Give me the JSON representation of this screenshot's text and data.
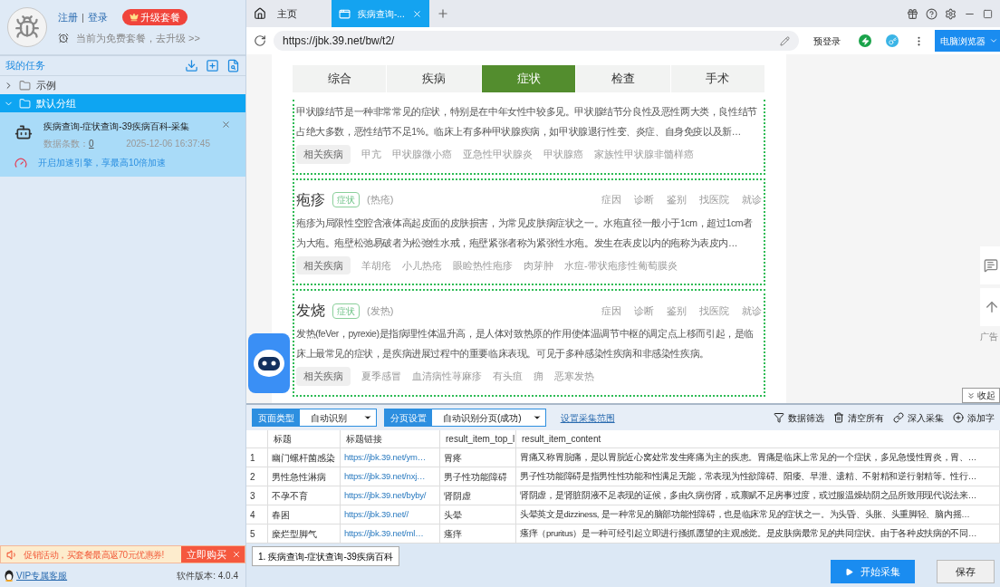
{
  "account": {
    "links": [
      "注册",
      "登录"
    ],
    "separator": "|",
    "upgrade_button": "升级套餐",
    "plan_note": "当前为免费套餐，去升级 >>"
  },
  "tasks": {
    "title": "我的任务",
    "groups": [
      {
        "label": "示例",
        "expanded": false,
        "selected": false
      },
      {
        "label": "默认分组",
        "expanded": true,
        "selected": true,
        "children": [
          {
            "title": "疾病查询-症状查询-39疾病百科-采集",
            "count_label": "数据条数：",
            "count": "0",
            "time": "2025-12-06 16:37:45",
            "boost": "开启加速引擎，享最高10倍加速"
          }
        ]
      }
    ]
  },
  "promo": {
    "text": "促销活动，买套餐最高返70元优惠券!",
    "button": "立即购买"
  },
  "footer": {
    "support_link": "VIP专属客服",
    "version": "软件版本: 4.0.4"
  },
  "browser": {
    "tabs": [
      {
        "label": "主页",
        "kind": "home",
        "selected": false
      },
      {
        "label": "疾病查询-...",
        "kind": "page",
        "selected": true
      }
    ],
    "url": "https://jbk.39.net/bw/t2/",
    "login": "预登录",
    "mode_button": "电脑浏览器"
  },
  "page": {
    "nav": [
      {
        "label": "综合",
        "selected": false
      },
      {
        "label": "疾病",
        "selected": false
      },
      {
        "label": "症状",
        "selected": true
      },
      {
        "label": "检查",
        "selected": false
      },
      {
        "label": "手术",
        "selected": false
      }
    ],
    "cards": [
      {
        "description": "甲状腺结节是一种非常常见的症状，特别是在中年女性中较多见。甲状腺结节分良性及恶性两大类，良性结节占绝大多数，恶性结节不足1%。临床上有多种甲状腺疾病，如甲状腺退行性变、炎症、自身免疫以及新…",
        "related_label": "相关疾病",
        "related": [
          "甲亢",
          "甲状腺微小癌",
          "亚急性甲状腺炎",
          "甲状腺癌",
          "家族性甲状腺非髓样癌"
        ]
      },
      {
        "name": "疱疹",
        "tag": "症状",
        "alias": "(热疮)",
        "links": [
          "症因",
          "诊断",
          "鉴别",
          "找医院",
          "就诊"
        ],
        "description": "疱疹为局限性空腔含液体高起皮面的皮肤损害，为常见皮肤病症状之一。水疱直径一般小于1cm，超过1cm者为大疱。疱壁松弛易破者为松弛性水戒，疱壁紧张者称为紧张性水疱。发生在表皮以内的疱称为表皮内…",
        "related_label": "相关疾病",
        "related": [
          "羊胡疮",
          "小儿热疮",
          "眼睑热性疱疹",
          "肉芽肿",
          "水痘-带状疱疹性葡萄膜炎"
        ]
      },
      {
        "name": "发烧",
        "tag": "症状",
        "alias": "(发热)",
        "links": [
          "症因",
          "诊断",
          "鉴别",
          "找医院",
          "就诊"
        ],
        "description": "发热(feVer，pyrexie)是指病理性体温升高，是人体对致热原的作用使体温调节中枢的调定点上移而引起，是临床上最常见的症状，是疾病进展过程中的重要临床表现。可见于多种感染性疾病和非感染性疾病。",
        "related_label": "相关疾病",
        "related": [
          "夏季感冒",
          "血清病性荨麻疹",
          "有头疽",
          "痈",
          "恶寒发热"
        ]
      }
    ],
    "ad_label": "广告",
    "collapse_button": "收起"
  },
  "collector": {
    "selects": [
      {
        "label": "页面类型",
        "value": "自动识别"
      },
      {
        "label": "分页设置",
        "value": "自动识别分页(成功)"
      }
    ],
    "range_link": "设置采集范围",
    "actions": [
      {
        "label": "数据筛选",
        "kind": "filter"
      },
      {
        "label": "清空所有",
        "kind": "trash"
      },
      {
        "label": "深入采集",
        "kind": "link"
      },
      {
        "label": "添加字",
        "kind": "add"
      }
    ],
    "table": {
      "columns": [
        "标题",
        "标题链接",
        "result_item_top_l",
        "result_item_content"
      ],
      "rows": [
        {
          "index": "1",
          "cells": [
            "幽门螺杆菌感染",
            "https://jbk.39.net/ym…",
            "胃疼",
            "胃痛又称胃脘痛，是以胃脘近心窝处常发生疼痛为主的疾患。胃痛是临床上常见的一个症状，多见急慢性胃炎，胃、…"
          ]
        },
        {
          "index": "2",
          "cells": [
            "男性急性淋病",
            "https://jbk.39.net/nxj…",
            "男子性功能障碍",
            "男子性功能障碍是指男性性功能和性满足无能，常表现为性欲障碍、阳痿、早泄、遗精、不射精和逆行射精等。性行…"
          ]
        },
        {
          "index": "3",
          "cells": [
            "不孕不育",
            "https://jbk.39.net/byby/",
            "肾阴虚",
            "肾阴虚，是肾脏阴液不足表现的证候，多由久病伤肾，或禀赋不足房事过度，或过服温燥劫阴之品所致用现代说法来…"
          ]
        },
        {
          "index": "4",
          "cells": [
            "春困",
            "https://jbk.39.net//",
            "头晕",
            "头晕英文是dizziness, 是一种常见的脑部功能性障碍，也是临床常见的症状之一。为头昏、头胀、头重脚轻、脑内摇…"
          ]
        },
        {
          "index": "5",
          "cells": [
            "糜烂型脚气",
            "https://jbk.39.net/ml…",
            "瘙痒",
            "瘙痒（pruritus）是一种可经引起立即进行搔抓愿望的主观感觉。是皮肤病最常见的共同症状。由于各种皮扶病的不同…"
          ]
        }
      ]
    },
    "task_tab": "1. 疾病查询-症状查询-39疾病百科",
    "start_button": "开始采集",
    "save_button": "保存"
  }
}
